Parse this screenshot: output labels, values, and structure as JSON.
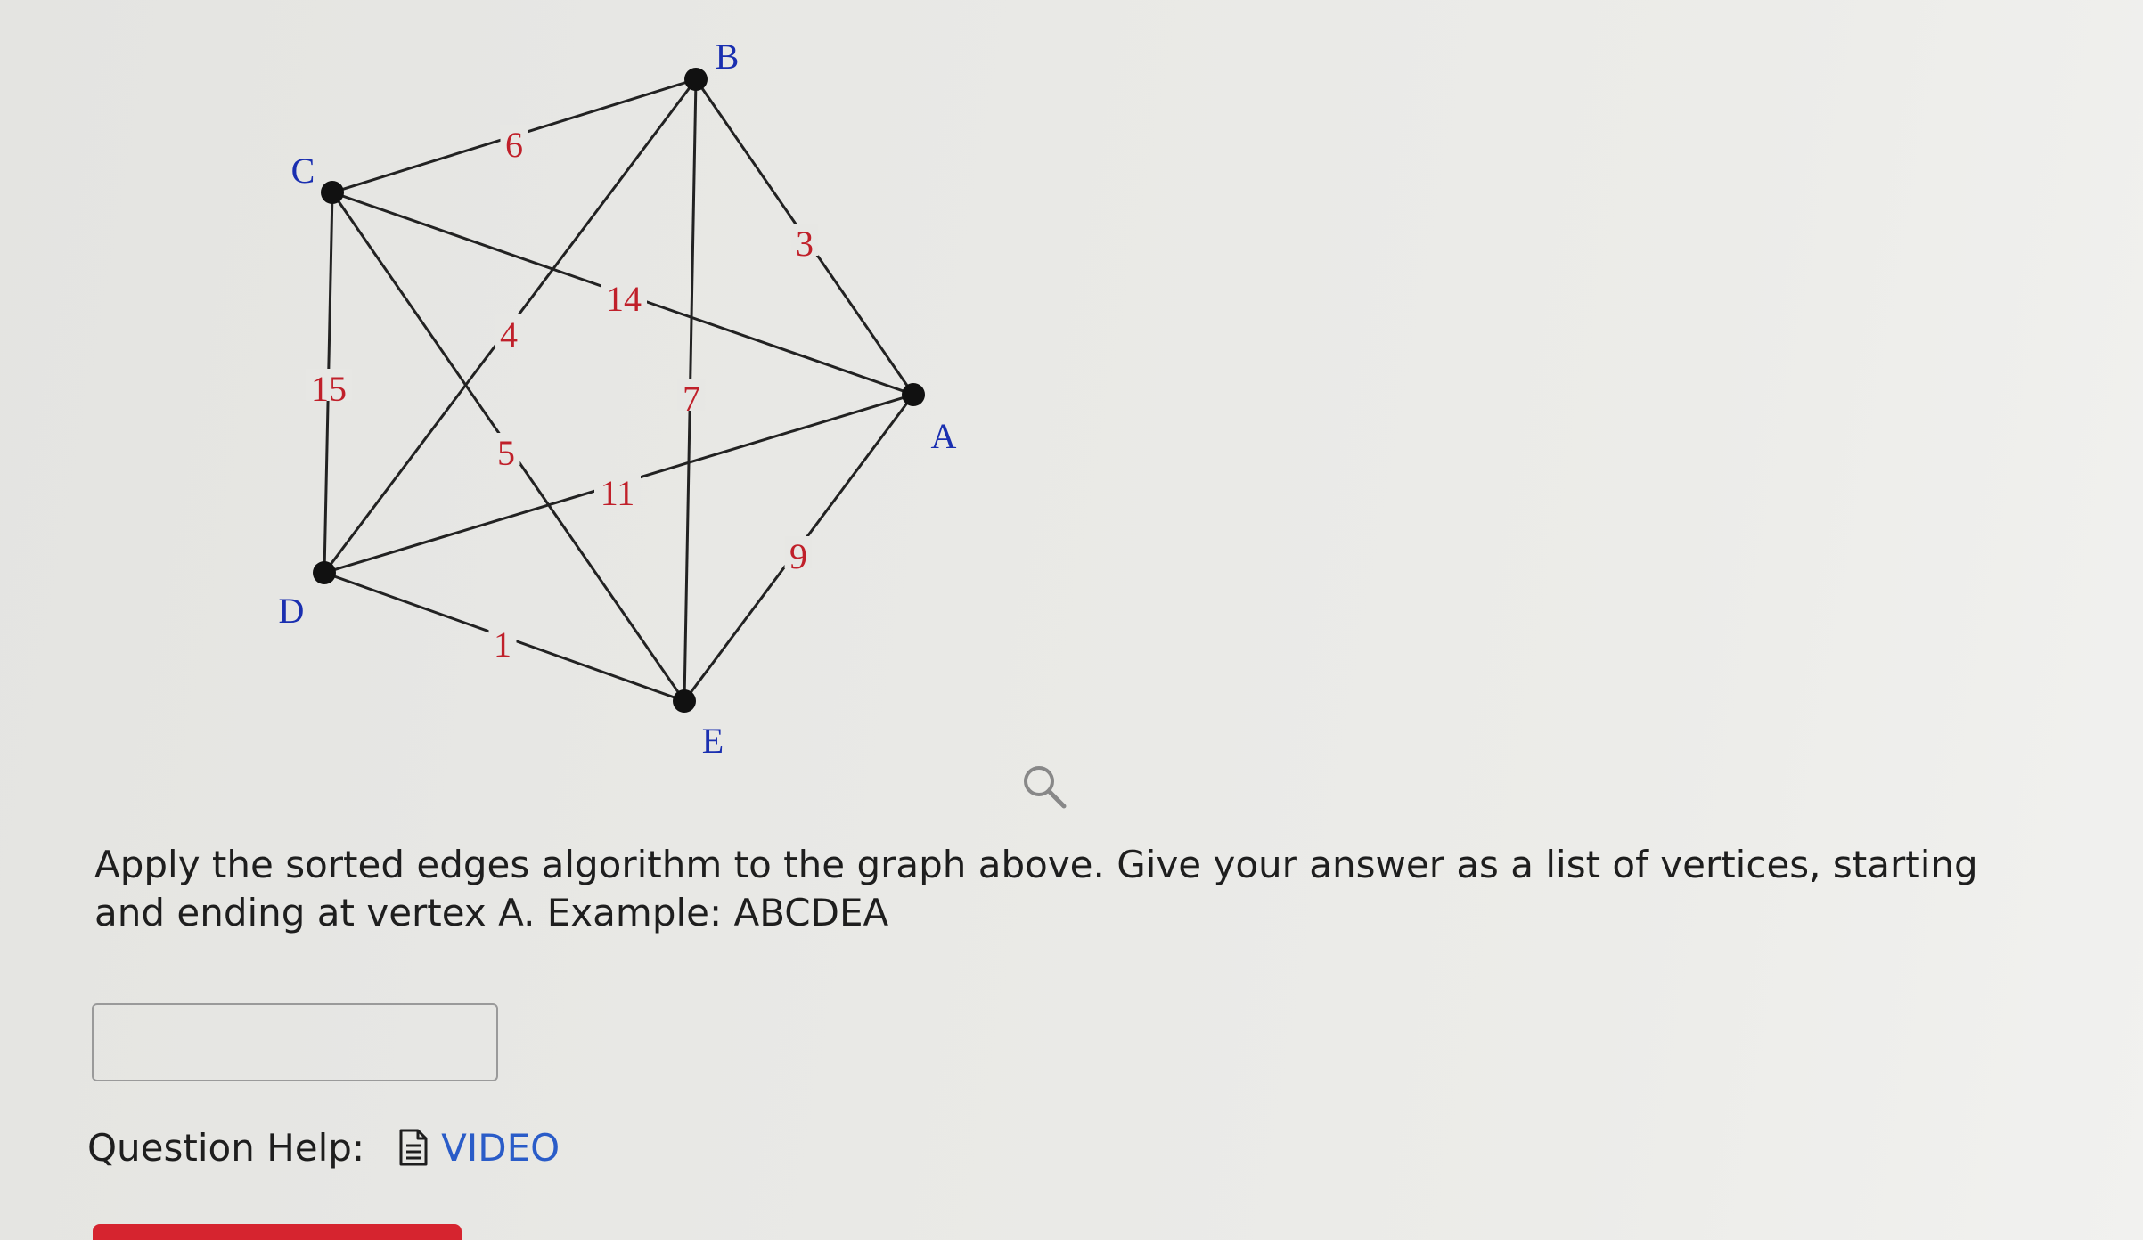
{
  "graph": {
    "vertices": [
      {
        "id": "B",
        "label": "B"
      },
      {
        "id": "C",
        "label": "C"
      },
      {
        "id": "A",
        "label": "A"
      },
      {
        "id": "D",
        "label": "D"
      },
      {
        "id": "E",
        "label": "E"
      }
    ],
    "edges": [
      {
        "from": "C",
        "to": "B",
        "weight": "6"
      },
      {
        "from": "B",
        "to": "A",
        "weight": "3"
      },
      {
        "from": "C",
        "to": "A",
        "weight": "14"
      },
      {
        "from": "B",
        "to": "D",
        "weight": "4"
      },
      {
        "from": "C",
        "to": "D",
        "weight": "15"
      },
      {
        "from": "B",
        "to": "E",
        "weight": "7"
      },
      {
        "from": "C",
        "to": "E",
        "weight": "5"
      },
      {
        "from": "D",
        "to": "A",
        "weight": "11"
      },
      {
        "from": "A",
        "to": "E",
        "weight": "9"
      },
      {
        "from": "D",
        "to": "E",
        "weight": "1"
      }
    ]
  },
  "question": {
    "text": "Apply the sorted edges algorithm to the graph above. Give your answer as a list of vertices, starting and ending at vertex A. Example: ABCDEA"
  },
  "answer": {
    "value": "",
    "placeholder": ""
  },
  "help": {
    "label": "Question Help:",
    "video_label": "VIDEO"
  },
  "colors": {
    "vertex_label": "#1a2fb0",
    "weight_label": "#c0202a",
    "link": "#2a5cc8",
    "submit": "#d6242f"
  },
  "icons": {
    "zoom": "magnifier-icon",
    "video": "document-icon"
  }
}
